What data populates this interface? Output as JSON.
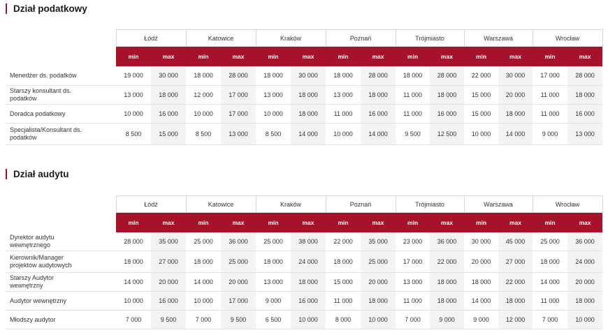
{
  "tax": {
    "title": "Dział podatkowy",
    "cities": [
      "Łódź",
      "Katowice",
      "Kraków",
      "Poznań",
      "Trójmiasto",
      "Warszawa",
      "Wrocław"
    ],
    "min_label": "min",
    "max_label": "max",
    "rows": [
      {
        "position": "Menedżer ds. podatków",
        "values": [
          "19 000",
          "30 000",
          "18 000",
          "28 000",
          "18 000",
          "30 000",
          "18 000",
          "28 000",
          "18 000",
          "28 000",
          "22 000",
          "30 000",
          "17 000",
          "28 000"
        ]
      },
      {
        "position": "Starszy konsultant ds. podatków",
        "values": [
          "13 000",
          "18 000",
          "12 000",
          "17 000",
          "13 000",
          "18 000",
          "13 000",
          "18 000",
          "11 000",
          "18 000",
          "15 000",
          "20 000",
          "11 000",
          "18 000"
        ]
      },
      {
        "position": "Doradca podatkowy",
        "values": [
          "10 000",
          "16 000",
          "10 000",
          "17 000",
          "10 000",
          "18 000",
          "11 000",
          "16 000",
          "11 000",
          "16 000",
          "15 000",
          "18 000",
          "11 000",
          "16 000"
        ]
      },
      {
        "position": "Specjalista/Konsultant ds. podatków",
        "values": [
          "8 500",
          "15 000",
          "8 500",
          "13 000",
          "8 500",
          "14 000",
          "10 000",
          "14 000",
          "9 500",
          "12 500",
          "10 000",
          "14 000",
          "9 000",
          "13 000"
        ]
      }
    ]
  },
  "audit": {
    "title": "Dział audytu",
    "cities": [
      "Łódź",
      "Katowice",
      "Kraków",
      "Poznań",
      "Trójmiasto",
      "Warszawa",
      "Wrocław"
    ],
    "min_label": "min",
    "max_label": "max",
    "rows": [
      {
        "position": "Dyrektor audytu wewnętrznego",
        "values": [
          "28 000",
          "35 000",
          "25 000",
          "36 000",
          "25 000",
          "38 000",
          "22 000",
          "35 000",
          "23 000",
          "36 000",
          "30 000",
          "45 000",
          "25 000",
          "36 000"
        ]
      },
      {
        "position": "Kierownik/Manager projektów audytowych",
        "values": [
          "18 000",
          "27 000",
          "18 000",
          "25 000",
          "18 000",
          "24 000",
          "18 000",
          "25 000",
          "17 000",
          "22 000",
          "20 000",
          "27 000",
          "18 000",
          "24 000"
        ]
      },
      {
        "position": "Starszy Audytor wewnętrzny",
        "values": [
          "14 000",
          "20 000",
          "14 000",
          "20 000",
          "13 000",
          "18 000",
          "15 000",
          "20 000",
          "13 000",
          "18 000",
          "18 000",
          "22 000",
          "14 000",
          "20 000"
        ]
      },
      {
        "position": "Audytor wewnętrzny",
        "values": [
          "10 000",
          "16 000",
          "10 000",
          "17 000",
          "9 000",
          "16 000",
          "11 000",
          "18 000",
          "11 000",
          "18 000",
          "14 000",
          "18 000",
          "11 000",
          "18 000"
        ]
      },
      {
        "position": "Młodszy audytor",
        "values": [
          "7 000",
          "9 500",
          "7 000",
          "9 500",
          "6 500",
          "10 000",
          "8 000",
          "10 000",
          "7 000",
          "9 000",
          "9 000",
          "12 000",
          "7 000",
          "10 000"
        ]
      }
    ]
  }
}
